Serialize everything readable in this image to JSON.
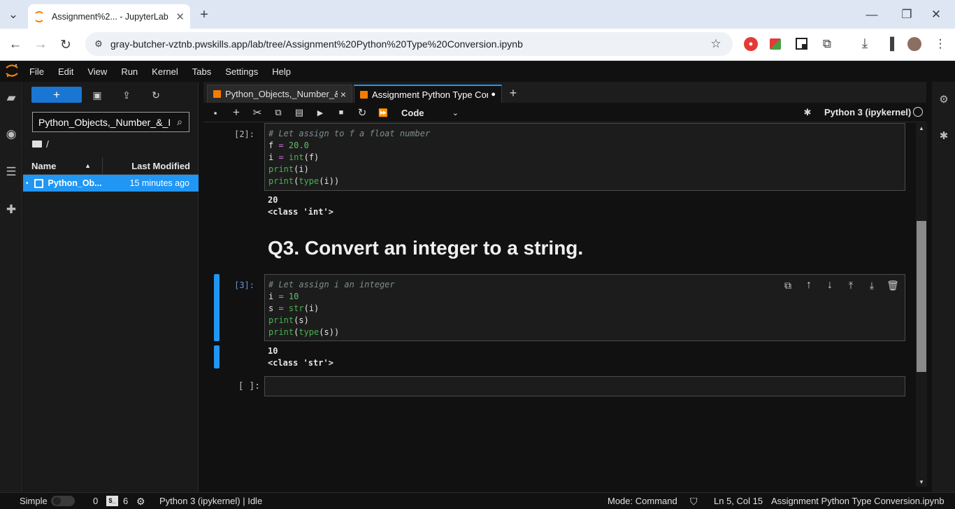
{
  "browser": {
    "tab_title": "Assignment%2... - JupyterLab",
    "url": "gray-butcher-vztnb.pwskills.app/lab/tree/Assignment%20Python%20Type%20Conversion.ipynb"
  },
  "menubar": [
    "File",
    "Edit",
    "View",
    "Run",
    "Kernel",
    "Tabs",
    "Settings",
    "Help"
  ],
  "filebrowser": {
    "new_label": "+",
    "filter_value": "Python_Objects,_Number_&_I",
    "breadcrumb": "/",
    "col_name": "Name",
    "col_modified": "Last Modified",
    "files": [
      {
        "name": "Python_Ob...",
        "modified": "15 minutes ago"
      }
    ]
  },
  "notebook_tabs": [
    {
      "label": "Python_Objects,_Number_&_",
      "close": "×"
    },
    {
      "label": "Assignment Python Type Cor",
      "close": "●"
    }
  ],
  "toolbar": {
    "cell_type": "Code",
    "kernel": "Python 3 (ipykernel)"
  },
  "cells": {
    "c2": {
      "prompt": "[2]:",
      "comment": "# Let assign to f a float number",
      "output1": "20",
      "output2": "<class 'int'>"
    },
    "heading": "Q3. Convert an integer to a string.",
    "c3": {
      "prompt": "[3]:",
      "comment": "# Let assign i an integer",
      "output1": "10",
      "output2": "<class 'str'>"
    },
    "c4": {
      "prompt": "[ ]:"
    }
  },
  "statusbar": {
    "simple": "Simple",
    "terminals": "0",
    "kernels": "6",
    "kernel_status": "Python 3 (ipykernel) | Idle",
    "mode": "Mode: Command",
    "position": "Ln 5, Col 15",
    "filename": "Assignment Python Type Conversion.ipynb"
  },
  "colors": {
    "accent": "#2196f3",
    "jupyter_orange": "#f57c00",
    "background": "#111111"
  }
}
